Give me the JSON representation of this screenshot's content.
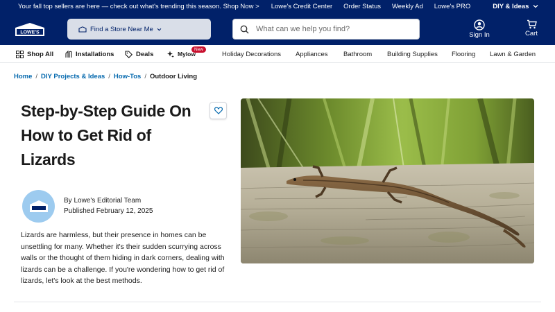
{
  "promo": {
    "text": "Your fall top sellers are here — check out what's trending this season. Shop Now >",
    "links": [
      "Lowe's Credit Center",
      "Order Status",
      "Weekly Ad",
      "Lowe's PRO"
    ],
    "diy_label": "DIY & Ideas"
  },
  "header": {
    "logo_text": "LOWE'S",
    "store_label": "Find a Store Near Me",
    "search_placeholder": "What can we help you find?",
    "signin_label": "Sign In",
    "cart_label": "Cart"
  },
  "nav": {
    "shop_all": "Shop All",
    "installations": "Installations",
    "deals": "Deals",
    "mylow": "Mylow",
    "mylow_badge": "New",
    "categories": [
      "Holiday Decorations",
      "Appliances",
      "Bathroom",
      "Building Supplies",
      "Flooring",
      "Lawn & Garden"
    ]
  },
  "breadcrumb": {
    "items": [
      "Home",
      "DIY Projects & Ideas",
      "How-Tos"
    ],
    "current": "Outdoor Living"
  },
  "article": {
    "title_lines": [
      "Step-by-Step Guide On",
      "How to Get Rid of",
      "Lizards"
    ],
    "author": "By Lowe's Editorial Team",
    "published": "Published February 12, 2025",
    "intro": "Lizards are harmless, but their presence in homes can be unsettling for many. Whether it's their sudden scurrying across walls or the thought of them hiding in dark corners, dealing with lizards can be a challenge. If you're wondering how to get rid of lizards, let's look at the best methods."
  },
  "colors": {
    "brand_navy": "#012169",
    "link_blue": "#0569ae",
    "badge_red": "#c8102e",
    "avatar_blue": "#9dcbef"
  },
  "icons": [
    "store-icon",
    "chevron-down-icon",
    "search-icon",
    "user-icon",
    "cart-icon",
    "grid-icon",
    "tools-icon",
    "tag-icon",
    "sparkle-icon",
    "heart-icon",
    "lowes-house-icon"
  ]
}
